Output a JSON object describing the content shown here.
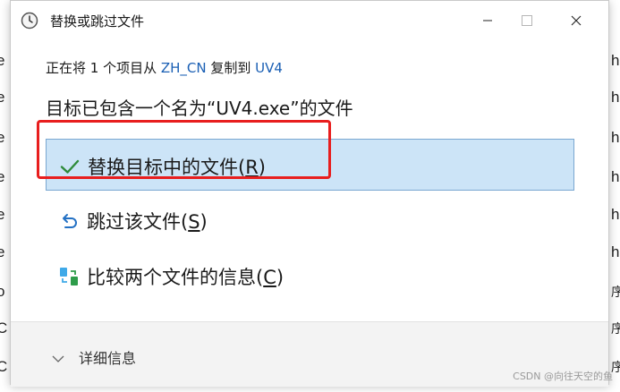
{
  "background": {
    "left_chars": [
      "e",
      "e",
      "e",
      "e",
      "e",
      "e",
      "o",
      "C",
      "C",
      "i"
    ],
    "right_chars": [
      "h",
      "h",
      "h",
      "h",
      "h",
      "h",
      "h",
      "序",
      "序",
      "序"
    ]
  },
  "dialog": {
    "title": "替换或跳过文件",
    "icon": "clock-icon",
    "summary": {
      "prefix": "正在将 1 个项目从 ",
      "source": "ZH_CN",
      "middle": " 复制到 ",
      "destination": "UV4"
    },
    "conflict_message": "目标已包含一个名为“UV4.exe”的文件",
    "options": [
      {
        "label_main": "替换目标中的文件(",
        "hotkey": "R",
        "label_end": ")",
        "icon": "checkmark-icon",
        "selected": true
      },
      {
        "label_main": "跳过该文件(",
        "hotkey": "S",
        "label_end": ")",
        "icon": "undo-icon",
        "selected": false
      },
      {
        "label_main": "比较两个文件的信息(",
        "hotkey": "C",
        "label_end": ")",
        "icon": "compare-icon",
        "selected": false
      }
    ],
    "details_label": "详细信息"
  },
  "colors": {
    "selected_bg": "#cce4f7",
    "link": "#1a5fb4",
    "highlight_box": "#e81e1e",
    "check_green": "#2e8b3a"
  },
  "watermark": "CSDN @向往天空的鱼"
}
